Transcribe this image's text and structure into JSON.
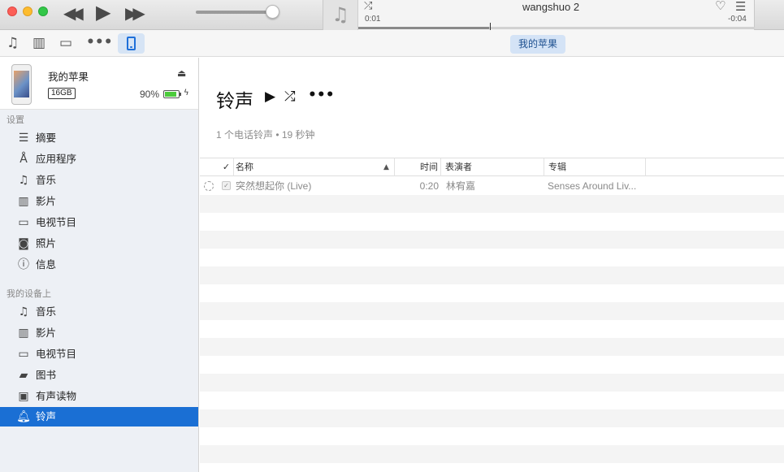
{
  "player": {
    "now_playing_title": "wangshuo 2",
    "elapsed": "0:01",
    "remaining": "-0:04",
    "progress": 0.33
  },
  "toolbar": {
    "device_pill_label": "我的苹果"
  },
  "device": {
    "name": "我的苹果",
    "capacity": "16GB",
    "battery_percent": "90%",
    "battery_level": 0.9
  },
  "sidebar": {
    "settings_title": "设置",
    "settings_items": [
      {
        "label": "摘要",
        "icon": "summary-icon"
      },
      {
        "label": "应用程序",
        "icon": "apps-icon"
      },
      {
        "label": "音乐",
        "icon": "music-note-icon"
      },
      {
        "label": "影片",
        "icon": "film-icon"
      },
      {
        "label": "电视节目",
        "icon": "tv-icon"
      },
      {
        "label": "照片",
        "icon": "camera-icon"
      },
      {
        "label": "信息",
        "icon": "info-icon"
      }
    ],
    "ondevice_title": "我的设备上",
    "ondevice_items": [
      {
        "label": "音乐",
        "icon": "music-note-icon"
      },
      {
        "label": "影片",
        "icon": "film-icon"
      },
      {
        "label": "电视节目",
        "icon": "tv-icon"
      },
      {
        "label": "图书",
        "icon": "book-icon"
      },
      {
        "label": "有声读物",
        "icon": "audiobook-icon"
      },
      {
        "label": "铃声",
        "icon": "bell-icon",
        "active": true
      }
    ]
  },
  "main": {
    "title": "铃声",
    "meta": "1 个电话铃声 • 19 秒钟",
    "columns": {
      "check": "✓",
      "name": "名称",
      "time": "时间",
      "artist": "表演者",
      "album": "专辑"
    },
    "rows": [
      {
        "name": "突然想起你 (Live)",
        "time": "0:20",
        "artist": "林宥嘉",
        "album": "Senses Around Liv..."
      }
    ]
  },
  "colors": {
    "accent": "#1a6fd4",
    "sidebar_bg": "#edf0f5",
    "device_pill_bg": "#d4e3f6"
  }
}
